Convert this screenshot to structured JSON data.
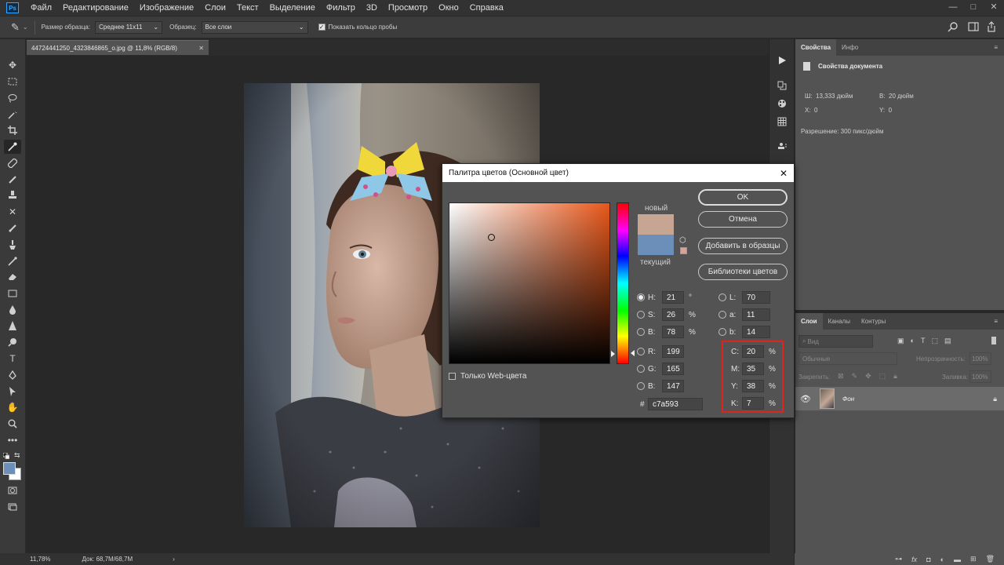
{
  "menu": {
    "logo": "Ps",
    "items": [
      "Файл",
      "Редактирование",
      "Изображение",
      "Слои",
      "Текст",
      "Выделение",
      "Фильтр",
      "3D",
      "Просмотр",
      "Окно",
      "Справка"
    ],
    "window_controls": [
      "—",
      "□",
      "✕"
    ]
  },
  "options_bar": {
    "sample_size_label": "Размер образца:",
    "sample_size_value": "Среднее 11х11",
    "sample_label": "Образец:",
    "sample_value": "Все слои",
    "show_ring_label": "Показать кольцо пробы",
    "show_ring_checked": true
  },
  "document": {
    "tab_title": "44724441250_4323846865_o.jpg @ 11,8% (RGB/8)",
    "tab_close": "✕"
  },
  "status_bar": {
    "zoom": "11,78%",
    "doc_info": "Док: 68,7M/68,7M",
    "arrow": "›"
  },
  "properties_panel": {
    "tabs": [
      "Свойства",
      "Инфо"
    ],
    "title": "Свойства документа",
    "w_label": "Ш:",
    "w_value": "13,333 дюйм",
    "h_label": "В:",
    "h_value": "20 дюйм",
    "x_label": "X:",
    "x_value": "0",
    "y_label": "Y:",
    "y_value": "0",
    "resolution": "Разрешение: 300 пикс/дюйм"
  },
  "layers_panel": {
    "tabs": [
      "Слои",
      "Каналы",
      "Контуры"
    ],
    "search_placeholder": "Вид",
    "blend_mode": "Обычные",
    "opacity_label": "Непрозрачность:",
    "opacity_value": "100%",
    "lock_label": "Закрепить:",
    "fill_label": "Заливка:",
    "fill_value": "100%",
    "layers": [
      {
        "name": "Фон",
        "visible": true,
        "locked": true
      }
    ]
  },
  "color_picker": {
    "title": "Палитра цветов (Основной цвет)",
    "close": "✕",
    "new_label": "новый",
    "current_label": "текущий",
    "new_color": "#c7a593",
    "current_color": "#6b8fb8",
    "ok_button": "OK",
    "cancel_button": "Отмена",
    "add_swatch_button": "Добавить в образцы",
    "libraries_button": "Библиотеки цветов",
    "web_only_label": "Только Web-цвета",
    "web_only_checked": false,
    "hsb": {
      "H": "21",
      "S": "26",
      "B": "78",
      "h_unit": "°",
      "s_unit": "%",
      "b_unit": "%"
    },
    "rgb": {
      "R": "199",
      "G": "165",
      "B": "147"
    },
    "lab": {
      "L": "70",
      "a": "11",
      "b": "14"
    },
    "cmyk": {
      "C": "20",
      "M": "35",
      "Y": "38",
      "K": "7",
      "unit": "%"
    },
    "hex_label": "#",
    "hex": "c7a593",
    "selected_mode": "H"
  },
  "colors": {
    "foreground": "#6b8fb8",
    "background": "#ffffff",
    "highlight": "#e0241b"
  }
}
